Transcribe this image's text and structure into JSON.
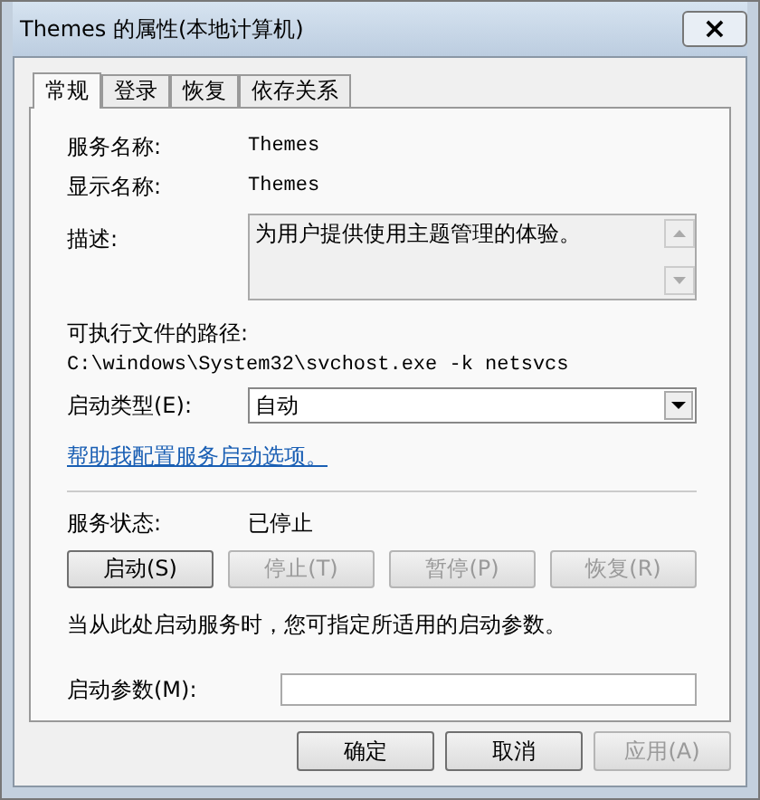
{
  "window": {
    "title": "Themes 的属性(本地计算机)",
    "close": "×"
  },
  "tabs": [
    {
      "label": "常规",
      "selected": true
    },
    {
      "label": "登录",
      "selected": false
    },
    {
      "label": "恢复",
      "selected": false
    },
    {
      "label": "依存关系",
      "selected": false
    }
  ],
  "service_name": {
    "label": "服务名称:",
    "value": "Themes"
  },
  "display_name": {
    "label": "显示名称:",
    "value": "Themes"
  },
  "description": {
    "label": "描述:",
    "value": "为用户提供使用主题管理的体验。"
  },
  "path": {
    "label": "可执行文件的路径:",
    "value": "C:\\windows\\System32\\svchost.exe -k netsvcs"
  },
  "startup_type": {
    "label": "启动类型(E):",
    "value": "自动"
  },
  "help_link": "帮助我配置服务启动选项。",
  "service_status": {
    "label": "服务状态:",
    "value": "已停止"
  },
  "service_buttons": [
    {
      "label": "启动(S)",
      "disabled": false
    },
    {
      "label": "停止(T)",
      "disabled": true
    },
    {
      "label": "暂停(P)",
      "disabled": true
    },
    {
      "label": "恢复(R)",
      "disabled": true
    }
  ],
  "note": "当从此处启动服务时，您可指定所适用的启动参数。",
  "start_params": {
    "label": "启动参数(M):"
  },
  "dialog_buttons": [
    {
      "label": "确定",
      "disabled": false
    },
    {
      "label": "取消",
      "disabled": false
    },
    {
      "label": "应用(A)",
      "disabled": true
    }
  ]
}
